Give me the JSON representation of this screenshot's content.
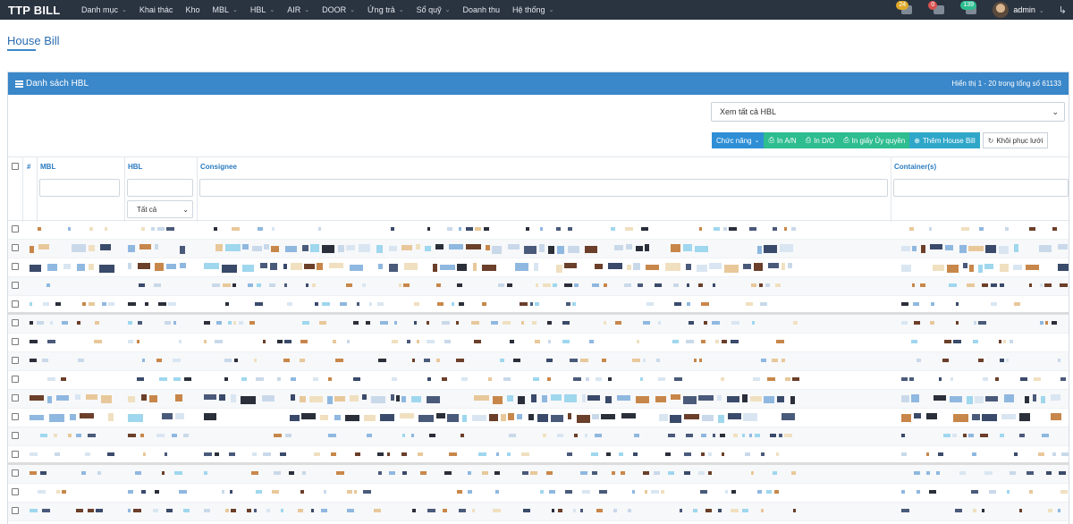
{
  "nav": {
    "brand": "TTP BILL",
    "items": [
      {
        "label": "Danh mục",
        "dropdown": true
      },
      {
        "label": "Khai thác",
        "dropdown": false
      },
      {
        "label": "Kho",
        "dropdown": false
      },
      {
        "label": "MBL",
        "dropdown": true
      },
      {
        "label": "HBL",
        "dropdown": true
      },
      {
        "label": "AIR",
        "dropdown": true
      },
      {
        "label": "DOOR",
        "dropdown": true
      },
      {
        "label": "Ứng trả",
        "dropdown": true
      },
      {
        "label": "Sổ quỹ",
        "dropdown": true
      },
      {
        "label": "Doanh thu",
        "dropdown": false
      },
      {
        "label": "Hệ thống",
        "dropdown": true
      }
    ],
    "badges": [
      {
        "count": "24",
        "color": "#e0a92a"
      },
      {
        "count": "0",
        "color": "#d9534f"
      },
      {
        "count": "139",
        "color": "#2ebd8f"
      }
    ],
    "user": "admin"
  },
  "page": {
    "title": "House Bill"
  },
  "panel": {
    "title": "Danh sách HBL",
    "info": "Hiển thị 1 - 20 trong tổng số 61133"
  },
  "view_select": {
    "value": "Xem tất cả HBL"
  },
  "toolbar": {
    "chuc_nang": "Chức năng",
    "in_an": "In A/N",
    "in_do": "In D/O",
    "in_uy_quyen": "In giấy Ủy quyền",
    "them_hbl": "Thêm House Bill",
    "khoi_phuc": "Khôi phục lưới"
  },
  "table": {
    "columns": {
      "index": "#",
      "mbl": "MBL",
      "hbl": "HBL",
      "consignee": "Consignee",
      "containers": "Container(s)"
    },
    "hbl_filter_value": "Tất cả",
    "row_count": 16
  }
}
